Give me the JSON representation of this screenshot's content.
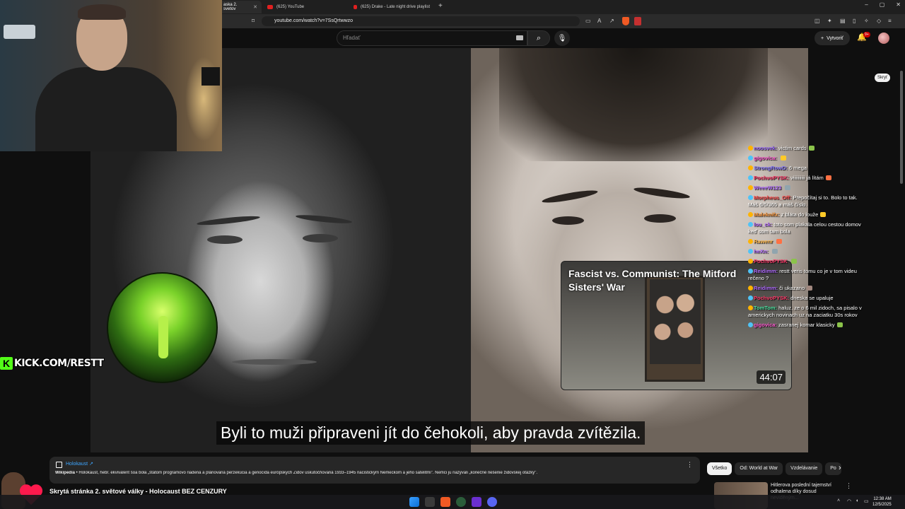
{
  "browser": {
    "tabs": [
      {
        "label": "aska 2. svetov",
        "active": true
      },
      {
        "label": "(625) YouTube",
        "active": false
      },
      {
        "label": "(625) Drake - Late night drive playlist",
        "active": false
      }
    ],
    "new_tab": "+",
    "url": "youtube.com/watch?v=7SsQrtwwzo",
    "window_controls": {
      "minimize": "–",
      "maximize": "▢",
      "close": "✕"
    }
  },
  "youtube": {
    "search_placeholder": "Hľadať",
    "create_label": "Vytvoriť",
    "notification_badge": "9+",
    "hide_label": "Skryť"
  },
  "video": {
    "subtitle": "Byli to muži připraveni jít do čehokoli, aby pravda zvítězila."
  },
  "recommended": {
    "title": "Fascist vs. Communist: The Mitford Sisters' War",
    "duration": "44:07"
  },
  "overlay": {
    "kick_logo": "K",
    "kick_url": "KICK.COM/RESTT"
  },
  "chat": [
    {
      "user": "noosvek:",
      "text": "victim cards",
      "color": "#9b6bff"
    },
    {
      "user": "gigovica:",
      "text": "",
      "color": "#ff5ad1"
    },
    {
      "user": "StrongRowD:",
      "text": "6 mega",
      "color": "#8a7bff"
    },
    {
      "user": "PochvoPYSK:",
      "text": "viiiiiiiiii  já lítám",
      "color": "#ff3b6b"
    },
    {
      "user": "WeeeW123",
      "text": "",
      "color": "#b06cff"
    },
    {
      "user": "Morpheus_Off:",
      "text": "Prepočítaj si to. Bolo to tak. Máš 6/5/365 a máš číslo.",
      "color": "#ff4d4d"
    },
    {
      "user": "Maleknifx:",
      "text": "z bláta do louže",
      "color": "#ff9a3c"
    },
    {
      "user": "lou_ck:",
      "text": "toto som plakala celou cestou domov keď som tam bola",
      "color": "#b56bff"
    },
    {
      "user": "Rawenr",
      "text": "",
      "color": "#ffb84d"
    },
    {
      "user": "heXn:",
      "text": "",
      "color": "#b06cff"
    },
    {
      "user": "PochvoPYSK",
      "text": "",
      "color": "#ff3b6b"
    },
    {
      "user": "Reidimm:",
      "text": "restt veris tomu co je v tom videu rečeno ?",
      "color": "#b06cff"
    },
    {
      "user": "Reidimm:",
      "text": "či ukazano",
      "color": "#b06cff"
    },
    {
      "user": "PochvoPYSK:",
      "text": "dneska se upaluje",
      "color": "#ff3b6b"
    },
    {
      "user": "TomTom:",
      "text": "haluz, ze o 6 mil zidoch, sa pisalo v americkych novinach uz na zaciatku 30s rokov",
      "color": "#4de0a0"
    },
    {
      "user": "gigovica:",
      "text": "zasranej komar klasicky",
      "color": "#ff5ad1"
    }
  ],
  "knowledge": {
    "title": "Holokaust",
    "source": "Wikipedia",
    "text": " • Holokaust, hebr. ekvivalent šoa bola „štátom programovo riadená a plánovaná perzekúcia a genocída európskych Židov uskutočňovaná 1933–1945 nacistickým Nemeckom a jeho satelitmi\". Nemci ju nazývali „konečné riešenie židovskej otázky\"."
  },
  "video_title": "Skrytá stránka 2. světové války - Holocaust BEZ CENZURY",
  "chips": [
    "Všetko",
    "Od: World at War",
    "Vzdelávanie",
    "Po"
  ],
  "sidebar_video": {
    "title": "Hitlerova poslední tajemství odhalena díky dosud neviděným..."
  },
  "taskbar": {
    "time": "12:38 AM",
    "date": "12/5/2025"
  },
  "colors": {
    "accent": "#3ea6ff",
    "kick_green": "#53fc18",
    "yt_red": "#e02020"
  }
}
